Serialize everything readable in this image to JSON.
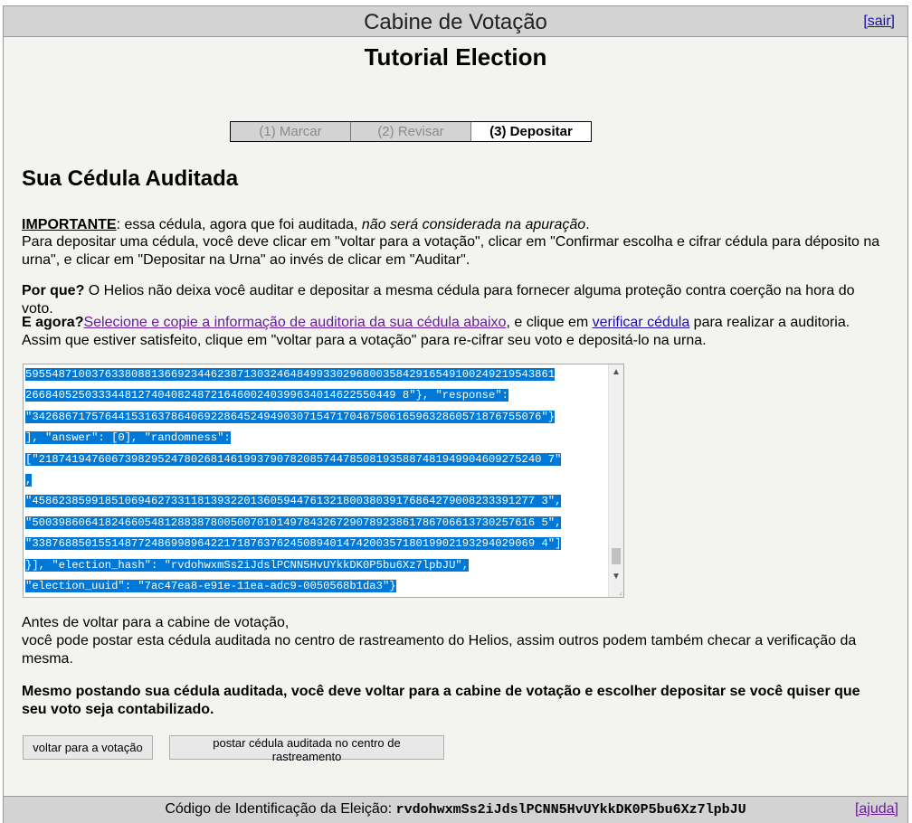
{
  "header": {
    "title": "Cabine de Votação",
    "logout_label": "[sair]"
  },
  "election": {
    "title": "Tutorial Election"
  },
  "steps": [
    {
      "label": "(1) Marcar",
      "state": "inactive"
    },
    {
      "label": "(2) Revisar",
      "state": "inactive"
    },
    {
      "label": "(3) Depositar",
      "state": "active"
    }
  ],
  "section": {
    "heading": "Sua Cédula Auditada"
  },
  "important": {
    "label": "IMPORTANTE",
    "text": ": essa cédula, agora que foi auditada, ",
    "emphasis": "não será considerada na apuração",
    "end": ".",
    "instructions": "Para depositar uma cédula, você deve clicar em \"voltar para a votação\", clicar em \"Confirmar escolha e cifrar cédula para déposito na urna\", e clicar em \"Depositar na Urna\" ao invés de clicar em \"Auditar\"."
  },
  "why": {
    "label": "Por que?",
    "text": " O Helios não deixa você auditar e depositar a mesma cédula para fornecer alguma proteção contra coerção na hora do voto."
  },
  "now": {
    "label": "E agora?",
    "select_link": "Selecione e copie a informação de auditoria da sua cédula abaixo",
    "middle": ", e clique em ",
    "verify_link": "verificar cédula",
    "end": " para realizar a auditoria.",
    "second_line": "Assim que estiver satisfeito, clique em \"voltar para a votação\" para re-cifrar seu voto e depositá-lo na urna."
  },
  "ballot_lines": [
    "59554871003763380881366923446238713032464849933029680035842916549100249219543861",
    "26684052503334481274040824872164600240399634014622550449 8\"}, \"response\":",
    "\"34268671757644153163786406922864524949030715471704675061659632860571876755076\"}",
    "], \"answer\": [0], \"randomness\":",
    "[\"2187419476067398295247802681461993790782085744785081935887481949904609275240 7\"",
    ",",
    "\"4586238599185106946273311813932201360594476132180038039176864279008233391277 3\",",
    "\"5003986064182466054812883878005007010149784326729078923861786706613730257616 5\",",
    "\"3387688501551487724869989642217187637624508940147420035718019902193294029069 4\"]",
    "}], \"election_hash\": \"rvdohwxmSs2iJdslPCNN5HvUYkkDK0P5bu6Xz7lpbJU\",",
    "\"election_uuid\": \"7ac47ea8-e91e-11ea-adc9-0050568b1da3\"}"
  ],
  "before": {
    "line1": "Antes de voltar para a cabine de votação,",
    "line2": "você pode postar esta cédula auditada no centro de rastreamento do Helios, assim outros podem também checar a verificação da mesma."
  },
  "must": {
    "text": "Mesmo postando sua cédula auditada, você deve voltar para a cabine de votação e escolher depositar se você quiser que seu voto seja contabilizado."
  },
  "buttons": {
    "back_label": "voltar para a votação",
    "post_label": "postar cédula auditada no centro de rastreamento"
  },
  "footer": {
    "label": "Código de Identificação da Eleição: ",
    "election_hash": "rvdohwxmSs2iJdslPCNN5HvUYkkDK0P5bu6Xz7lpbJU",
    "help_label": "[ajuda]"
  },
  "icons": {
    "scroll_up": "chevron-up-icon",
    "scroll_down": "chevron-down-icon",
    "resize": "resize-grip-icon"
  },
  "colors": {
    "selection": "#0078d7",
    "header_bg": "#d3d3d3",
    "page_bg": "#f3f4f0",
    "link": "#1a0dab",
    "visited_link": "#6a1b9a"
  }
}
